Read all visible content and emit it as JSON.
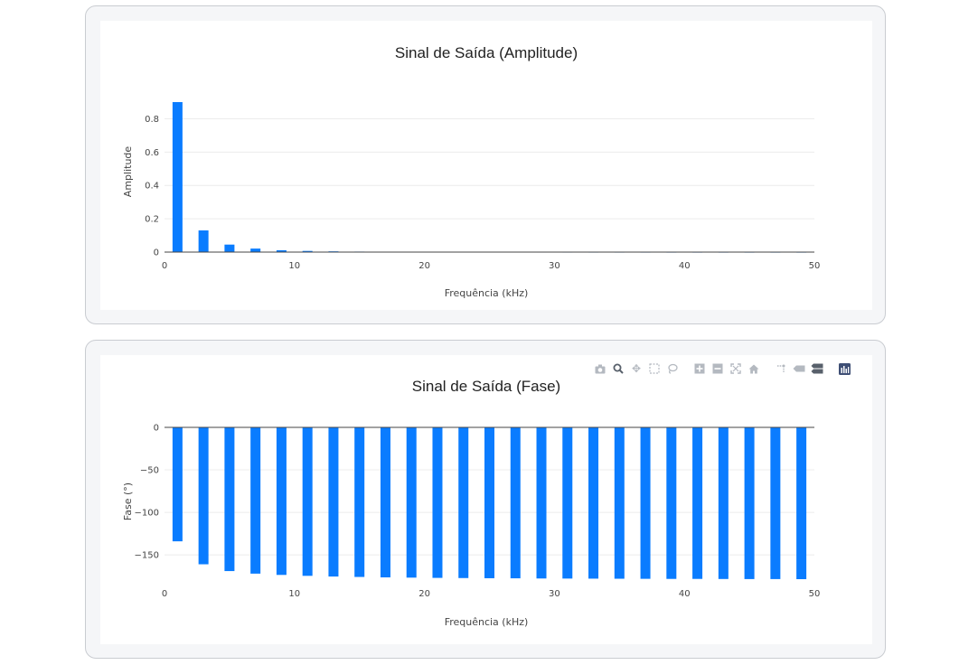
{
  "colors": {
    "bar": "#0a7cff",
    "panel_bg": "#f5f6f8",
    "plot_bg": "#ffffff"
  },
  "modebar": {
    "buttons": [
      "camera-icon",
      "zoom-icon",
      "pan-icon",
      "box-select-icon",
      "lasso-icon",
      "zoom-in-icon",
      "zoom-out-icon",
      "autoscale-icon",
      "reset-axes-icon",
      "spike-lines-icon",
      "hover-closest-icon",
      "hover-compare-icon",
      "plotly-logo-icon"
    ]
  },
  "chart_data": [
    {
      "type": "bar",
      "title": "Sinal de Saída (Amplitude)",
      "xlabel": "Frequência (kHz)",
      "ylabel": "Amplitude",
      "x": [
        1,
        3,
        5,
        7,
        9,
        11,
        13,
        15,
        17,
        19,
        21,
        23,
        25,
        27,
        29,
        31,
        33,
        35,
        37,
        39,
        41,
        43,
        45,
        47,
        49
      ],
      "values": [
        0.9,
        0.13,
        0.045,
        0.021,
        0.011,
        0.007,
        0.0045,
        0.003,
        0.0022,
        0.0015,
        0.0012,
        0.0009,
        0.0007,
        0.0006,
        0.0005,
        0.0004,
        0.00035,
        0.0003,
        0.00025,
        0.0002,
        0.00018,
        0.00016,
        0.00014,
        0.00012,
        0.0001
      ],
      "xlim": [
        0,
        50
      ],
      "ylim": [
        0,
        0.9
      ],
      "xticks": [
        "0",
        "10",
        "20",
        "30",
        "40",
        "50"
      ],
      "yticks": [
        "0",
        "0.2",
        "0.4",
        "0.6",
        "0.8"
      ],
      "grid": true
    },
    {
      "type": "bar",
      "title": "Sinal de Saída (Fase)",
      "xlabel": "Frequência (kHz)",
      "ylabel": "Fase (°)",
      "x": [
        1,
        3,
        5,
        7,
        9,
        11,
        13,
        15,
        17,
        19,
        21,
        23,
        25,
        27,
        29,
        31,
        33,
        35,
        37,
        39,
        41,
        43,
        45,
        47,
        49
      ],
      "values": [
        -134,
        -161,
        -169,
        -172,
        -173.5,
        -174.6,
        -175.4,
        -175.9,
        -176.4,
        -176.7,
        -177,
        -177.2,
        -177.4,
        -177.5,
        -177.7,
        -177.8,
        -177.9,
        -178,
        -178.1,
        -178.2,
        -178.2,
        -178.3,
        -178.4,
        -178.4,
        -178.5
      ],
      "xlim": [
        0,
        50
      ],
      "ylim": [
        -178.5,
        0
      ],
      "xticks": [
        "0",
        "10",
        "20",
        "30",
        "40",
        "50"
      ],
      "yticks": [
        "0",
        "−50",
        "−100",
        "−150"
      ],
      "grid": true
    }
  ]
}
